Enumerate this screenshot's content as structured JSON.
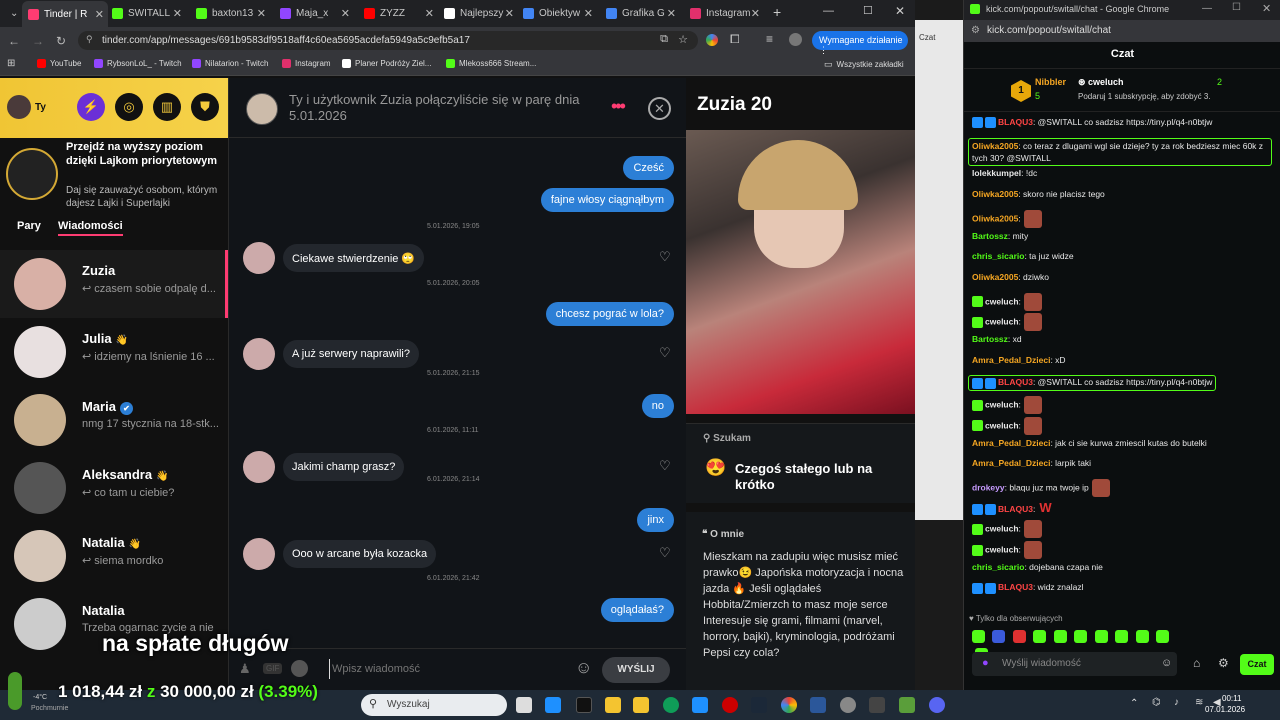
{
  "browser_left": {
    "tabs": [
      {
        "title": "Tinder | R",
        "active": true,
        "color": "#fe3c72"
      },
      {
        "title": "SWITALL",
        "color": "#53fc18"
      },
      {
        "title": "baxton13",
        "color": "#53fc18"
      },
      {
        "title": "Maja_x",
        "color": "#9146ff"
      },
      {
        "title": "ZYZZ",
        "color": "#ff0000"
      },
      {
        "title": "Najlepszy",
        "color": "#ffffff"
      },
      {
        "title": "Obiektyw",
        "color": "#4285f4"
      },
      {
        "title": "Grafika G",
        "color": "#4285f4"
      },
      {
        "title": "Instagram",
        "color": "#e1306c"
      }
    ],
    "url": "tinder.com/app/messages/691b9583df9518aff4c60ea5695acdefa5949a5c9efb5a17",
    "action_required": "Wymagane działanie",
    "bookmarks": [
      "YouTube",
      "RybsonLoL_ - Twitch",
      "Nilatarion - Twitch",
      "Instagram",
      "Planer Podróży Ziel...",
      "Mlekoss666 Stream..."
    ],
    "all_bookmarks": "Wszystkie zakładki"
  },
  "tinder": {
    "user_label": "Ty",
    "promo_title": "Przejdź na wyższy poziom dzięki Lajkom priorytetowym",
    "promo_sub": "Daj się zauważyć osobom, którym dajesz Lajki i Superlajki",
    "tab_matches": "Pary",
    "tab_messages": "Wiadomości",
    "conversations": [
      {
        "name": "Zuzia",
        "preview": "↩ czasem sobie odpalę d...",
        "selected": true
      },
      {
        "name": "Julia",
        "preview": "↩ idziemy na lśnienie 16 ...",
        "emoji": "👋"
      },
      {
        "name": "Maria",
        "preview": "nmg 17 stycznia na 18-stk...",
        "verified": true
      },
      {
        "name": "Aleksandra",
        "preview": "↩ co tam u ciebie?",
        "emoji": "👋"
      },
      {
        "name": "Natalia",
        "preview": "↩ siema mordko",
        "emoji": "👋"
      },
      {
        "name": "Natalia",
        "preview": "Trzeba ogarnac zycie a nie"
      }
    ],
    "chat_header": "Ty i użytkownik Zuzia połączyliście się w parę dnia 5.01.2026",
    "messages": [
      {
        "side": "right",
        "text": "Cześć"
      },
      {
        "side": "right",
        "text": "fajne włosy ciągnąłbym"
      },
      {
        "stamp": "5.01.2026, 19:05"
      },
      {
        "side": "left",
        "text": "Ciekawe stwierdzenie 🙄"
      },
      {
        "stamp": "5.01.2026, 20:05"
      },
      {
        "side": "right",
        "text": "chcesz pograć w lola?"
      },
      {
        "side": "left",
        "text": "A już serwery naprawili?"
      },
      {
        "stamp": "5.01.2026, 21:15"
      },
      {
        "side": "right",
        "text": "no"
      },
      {
        "stamp": "6.01.2026, 11:11"
      },
      {
        "side": "left",
        "text": "Jakimi champ grasz?"
      },
      {
        "stamp": "6.01.2026, 21:14"
      },
      {
        "side": "right",
        "text": "jinx"
      },
      {
        "side": "left",
        "text": "Ooo w arcane była kozacka"
      },
      {
        "stamp": "6.01.2026, 21:42"
      },
      {
        "side": "right",
        "text": "oglądałaś?"
      }
    ],
    "composer_placeholder": "Wpisz wiadomość",
    "send_label": "WYŚLIJ",
    "gif_label": "GIF",
    "profile_name": "Zuzia 20",
    "looking_label": "Szukam",
    "looking_value": "Czegoś stałego lub na krótko",
    "about_label": "O mnie",
    "about_text": "Mieszkam na zadupiu więc musisz mieć prawko😉 Japońska motoryzacja i nocna jazda 🔥 Jeśli oglądałeś Hobbita/Zmierzch to masz moje serce Interesuje się grami, filmami (marvel, horrory, bajki), kryminologia, podróżami Pepsi czy cola?"
  },
  "kick": {
    "window_title": "kick.com/popout/switall/chat - Google Chrome",
    "url": "kick.com/popout/switall/chat",
    "panel_title": "Czat",
    "top_gifter_name": "Nibbler",
    "top_gifter_rank": "1",
    "top_gifter_count": "5",
    "top2_name": "cweluch",
    "top2_count": "2",
    "top2_note": "Podaruj 1 subskrypcję, aby zdobyć 3.",
    "lines": [
      {
        "user": "BLAQU3",
        "color": "#ff4545",
        "text": ": @SWITALL co sadzisz https://tiny.pl/q4-n0btjw",
        "link": true
      },
      {
        "user": "Oliwka2005",
        "color": "#f5a623",
        "text": ": co teraz z dlugami wgl sie dzieje? ty za rok bedziesz miec 60k z tych 30? @SWITALL",
        "highlight": true
      },
      {
        "user": "lolekkumpel",
        "color": "#e8e8e8",
        "text": ": !dc"
      },
      {
        "user": "Oliwka2005",
        "color": "#f5a623",
        "text": ": skoro nie placisz tego"
      },
      {
        "user": "Oliwka2005",
        "color": "#f5a623",
        "text": ":",
        "emote": true
      },
      {
        "user": "Bartossz",
        "color": "#53fc18",
        "text": ": mity"
      },
      {
        "user": "chris_sicario",
        "color": "#53fc18",
        "text": ": ta juz widze"
      },
      {
        "user": "Oliwka2005",
        "color": "#f5a623",
        "text": ": dziwko"
      },
      {
        "user": "cweluch",
        "color": "#e8e8e8",
        "text": ":",
        "emote": true
      },
      {
        "user": "cweluch",
        "color": "#e8e8e8",
        "text": ":",
        "emote": true
      },
      {
        "user": "Bartossz",
        "color": "#53fc18",
        "text": ": xd"
      },
      {
        "user": "Amra_Pedal_Dzieci",
        "color": "#f5a623",
        "text": ": xD"
      },
      {
        "user": "BLAQU3",
        "color": "#ff4545",
        "text": ": @SWITALL co sadzisz https://tiny.pl/q4-n0btjw",
        "link": true,
        "highlight": true
      },
      {
        "user": "cweluch",
        "color": "#e8e8e8",
        "text": ":",
        "emote": true
      },
      {
        "user": "cweluch",
        "color": "#e8e8e8",
        "text": ":",
        "emote": true
      },
      {
        "user": "Amra_Pedal_Dzieci",
        "color": "#f5a623",
        "text": ": jak ci sie kurwa zmiescil kutas do butelki"
      },
      {
        "user": "Amra_Pedal_Dzieci",
        "color": "#f5a623",
        "text": ": larpik taki"
      },
      {
        "user": "drokeyy",
        "color": "#c79bff",
        "text": ": blaqu juz ma twoje ip",
        "emote": true
      },
      {
        "user": "BLAQU3",
        "color": "#ff4545",
        "text": ":",
        "w": "W"
      },
      {
        "user": "cweluch",
        "color": "#e8e8e8",
        "text": ":",
        "emote": true
      },
      {
        "user": "cweluch",
        "color": "#e8e8e8",
        "text": ":",
        "emote": true
      },
      {
        "user": "chris_sicario",
        "color": "#53fc18",
        "text": ": dojebana czapa nie"
      },
      {
        "user": "BLAQU3",
        "color": "#ff4545",
        "text": ": widz znalazl"
      }
    ],
    "followers_only": "Tylko dla obserwujących",
    "input_placeholder": "Wyślij wiadomość",
    "send_label": "Czat"
  },
  "overlay": {
    "caption": "na spłate długów",
    "debt_current": "1 018,44 zł",
    "debt_sep": "z",
    "debt_total": "30 000,00 zł",
    "debt_pct": "(3.39%)",
    "debt_progress_pct": 3.39,
    "weather": "-4°C",
    "weather_sub": "Pochmurnie"
  },
  "taskbar": {
    "search_placeholder": "Wyszukaj",
    "time": "00:11",
    "date": "07.01.2026"
  }
}
